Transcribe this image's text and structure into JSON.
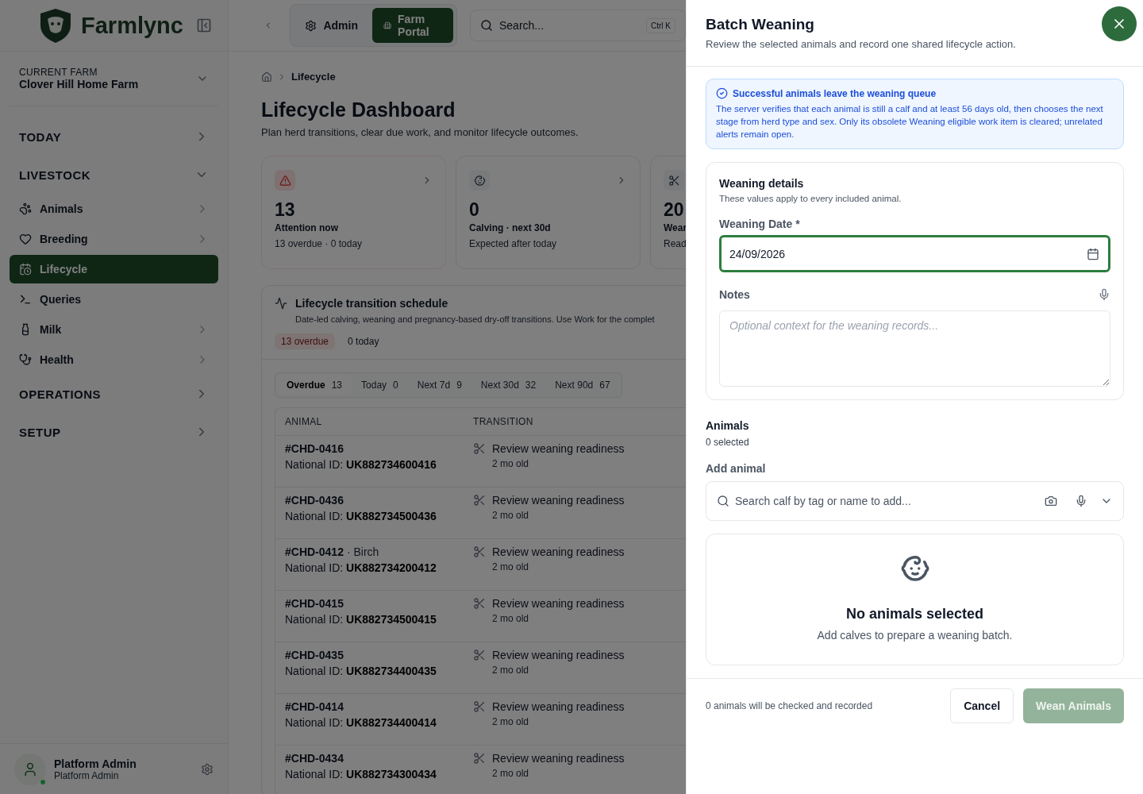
{
  "brand": {
    "name": "Farmlync"
  },
  "sidebar": {
    "farm_label": "CURRENT FARM",
    "farm_name": "Clover Hill Home Farm",
    "sections": [
      {
        "label": "TODAY",
        "expanded": false
      },
      {
        "label": "LIVESTOCK",
        "expanded": true,
        "items": [
          {
            "label": "Animals",
            "selected": false,
            "has_children": true
          },
          {
            "label": "Breeding",
            "selected": false,
            "has_children": true
          },
          {
            "label": "Lifecycle",
            "selected": true,
            "has_children": false
          },
          {
            "label": "Queries",
            "selected": false,
            "has_children": false
          },
          {
            "label": "Milk",
            "selected": false,
            "has_children": true
          },
          {
            "label": "Health",
            "selected": false,
            "has_children": true
          }
        ]
      },
      {
        "label": "OPERATIONS",
        "expanded": false
      },
      {
        "label": "SETUP",
        "expanded": false
      }
    ],
    "user": {
      "name": "Platform Admin",
      "role": "Platform Admin"
    }
  },
  "topbar": {
    "tabs": [
      {
        "label": "Admin",
        "selected": false
      },
      {
        "label": "Farm Portal",
        "selected": true
      }
    ],
    "search": {
      "placeholder": "Search...",
      "shortcut": "Ctrl K"
    }
  },
  "page": {
    "breadcrumb": "Lifecycle",
    "title": "Lifecycle Dashboard",
    "subtitle": "Plan herd transitions, clear due work, and monitor lifecycle outcomes.",
    "stats": [
      {
        "kind": "warning",
        "value": "13",
        "label": "Attention now",
        "sub": "13 overdue · 0 today"
      },
      {
        "kind": "normal",
        "value": "0",
        "label": "Calving · next 30d",
        "sub": "Expected after today"
      },
      {
        "kind": "normal",
        "value": "20",
        "label": "Wear",
        "sub": "Read"
      }
    ],
    "schedule": {
      "title": "Lifecycle transition schedule",
      "description": "Date-led calving, weaning and pregnancy-based dry-off transitions. Use Work for the complet",
      "badges": [
        {
          "label": "13 overdue",
          "kind": "danger"
        },
        {
          "label": "0 today",
          "kind": "neutral"
        }
      ]
    },
    "filters": [
      {
        "label": "Overdue",
        "count": "13",
        "selected": true
      },
      {
        "label": "Today",
        "count": "0",
        "selected": false
      },
      {
        "label": "Next 7d",
        "count": "9",
        "selected": false
      },
      {
        "label": "Next 30d",
        "count": "32",
        "selected": false
      },
      {
        "label": "Next 90d",
        "count": "67",
        "selected": false
      }
    ],
    "table": {
      "columns": [
        "ANIMAL",
        "TRANSITION"
      ],
      "rows": [
        {
          "tag": "#CHD-0416",
          "national_id": "National ID: **UK882734600416**",
          "transition": "Review weaning readiness",
          "age": "2 mo old"
        },
        {
          "tag": "#CHD-0436",
          "national_id": "National ID: **UK882734500436**",
          "transition": "Review weaning readiness",
          "age": "2 mo old"
        },
        {
          "tag": "#CHD-0412",
          "name": "· Birch",
          "national_id": "National ID: **UK882734200412**",
          "transition": "Review weaning readiness",
          "age": "2 mo old"
        },
        {
          "tag": "#CHD-0415",
          "national_id": "National ID: **UK882734500415**",
          "transition": "Review weaning readiness",
          "age": "2 mo old"
        },
        {
          "tag": "#CHD-0435",
          "national_id": "National ID: **UK882734400435**",
          "transition": "Review weaning readiness",
          "age": "2 mo old"
        },
        {
          "tag": "#CHD-0414",
          "national_id": "National ID: **UK882734400414**",
          "transition": "Review weaning readiness",
          "age": "2 mo old"
        },
        {
          "tag": "#CHD-0434",
          "national_id": "National ID: **UK882734300434**",
          "transition": "Review weaning readiness",
          "age": "2 mo old"
        }
      ]
    }
  },
  "drawer": {
    "title": "Batch Weaning",
    "subtitle": "Review the selected animals and record one shared lifecycle action.",
    "info": {
      "title": "Successful animals leave the weaning queue",
      "body": "The server verifies that each animal is still a calf and at least 56 days old, then chooses the next stage from herd type and sex. Only its obsolete Weaning eligible work item is cleared; unrelated alerts remain open."
    },
    "details": {
      "title": "Weaning details",
      "subtitle": "These values apply to every included animal.",
      "date": {
        "label": "Weaning Date *",
        "value": "24/09/2026",
        "focused": true
      },
      "notes": {
        "label": "Notes",
        "placeholder": "Optional context for the weaning records..."
      }
    },
    "animals": {
      "title": "Animals",
      "count": "0 selected"
    },
    "add_animal": {
      "label": "Add animal",
      "placeholder": "Search calf by tag or name to add..."
    },
    "empty": {
      "title": "No animals selected",
      "body": "Add calves to prepare a weaning batch."
    },
    "footer": {
      "summary": "0 animals will be checked and recorded",
      "buttons": [
        {
          "label": "Cancel",
          "kind": "secondary",
          "disabled": false
        },
        {
          "label": "Wean Animals",
          "kind": "primary",
          "disabled": true
        }
      ]
    }
  }
}
